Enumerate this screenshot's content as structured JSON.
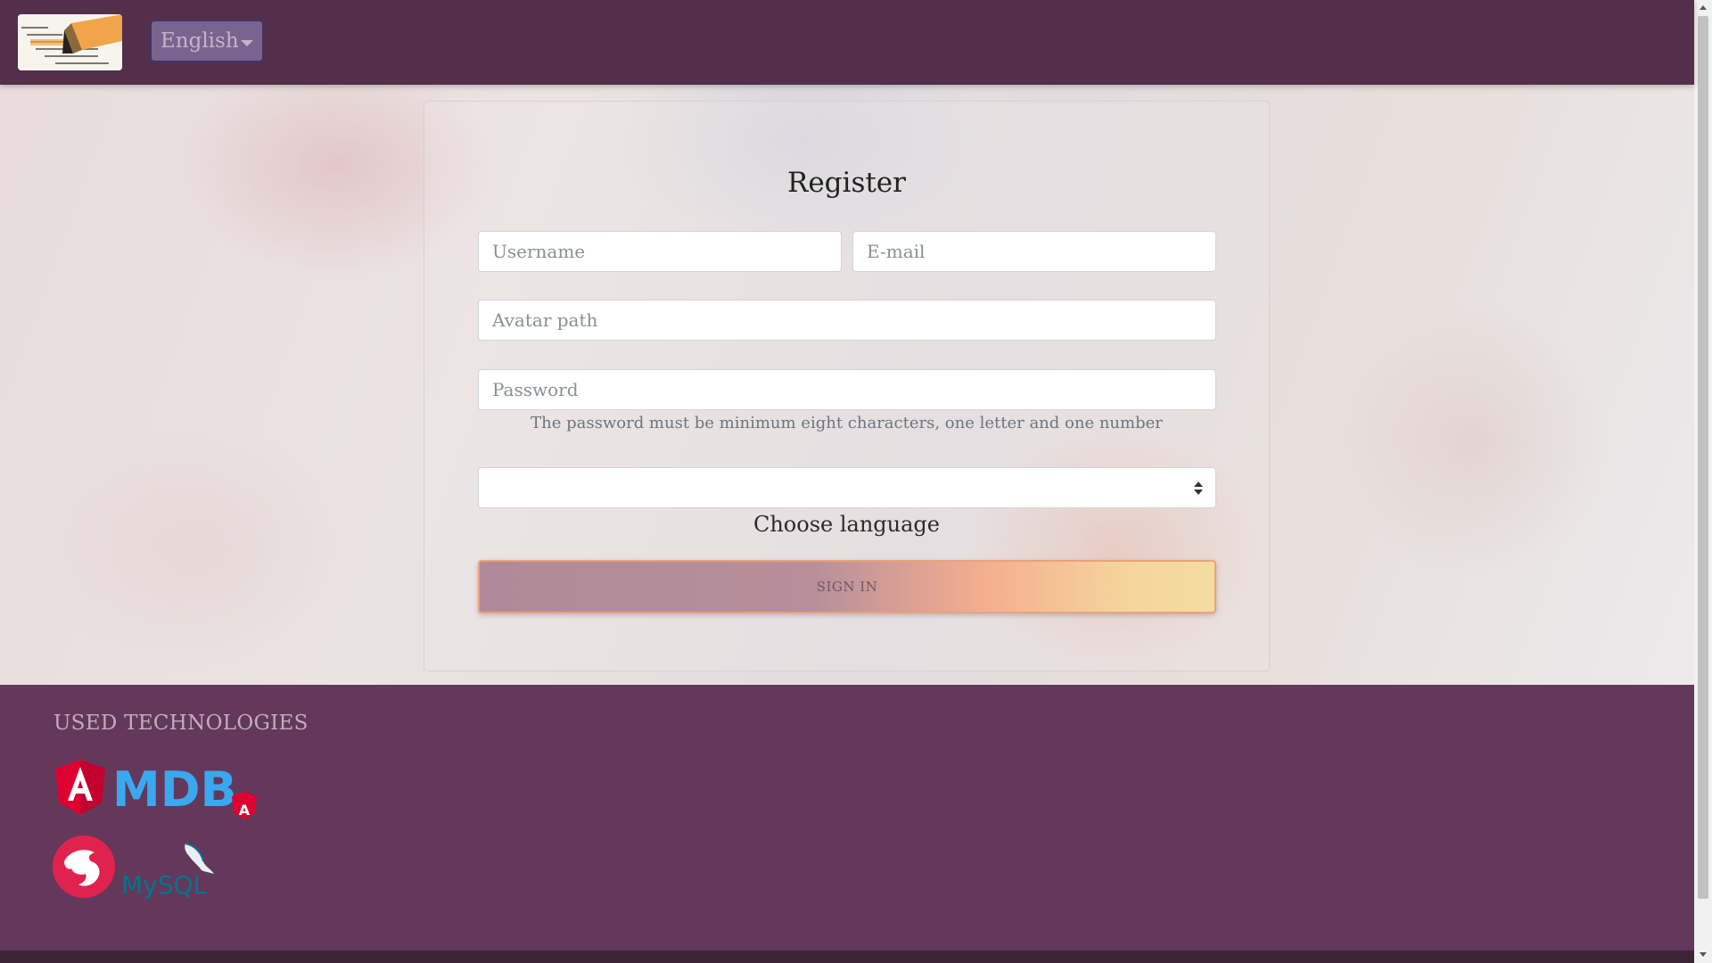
{
  "navbar": {
    "logo_alt": "Business",
    "language_button": "English"
  },
  "form": {
    "title": "Register",
    "username_placeholder": "Username",
    "email_placeholder": "E-mail",
    "avatar_placeholder": "Avatar path",
    "password_placeholder": "Password",
    "password_hint": "The password must be minimum eight characters, one letter and one number",
    "language_select_value": "",
    "language_label": "Choose language",
    "submit_label": "SIGN IN"
  },
  "footer": {
    "title": "USED TECHNOLOGIES",
    "logos": [
      "angular-logo",
      "mdb-logo",
      "angular-badge-logo",
      "nestjs-logo",
      "mysql-logo"
    ],
    "logo_text": {
      "mdb": "MDB",
      "angular": "A",
      "mysql": "MySQL"
    }
  },
  "colors": {
    "navbar": "#532f4b",
    "footer": "#64385a",
    "angular_red": "#dd0031",
    "mdb_blue": "#3aa8ef",
    "mysql_blue": "#00758f",
    "mysql_orange": "#f29111"
  }
}
